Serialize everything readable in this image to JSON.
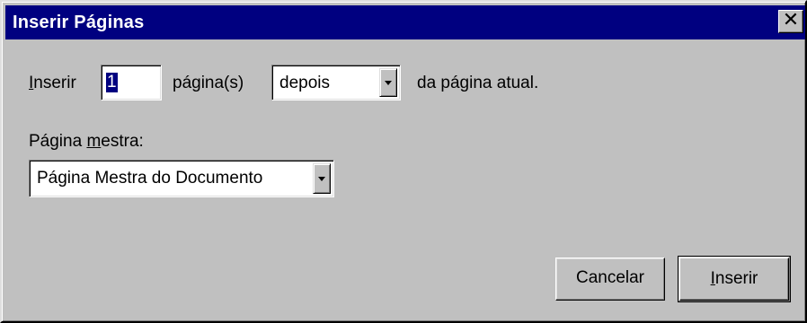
{
  "window": {
    "title": "Inserir Páginas",
    "close_glyph": "✕",
    "close_icon": "close-icon"
  },
  "insert_row": {
    "label_prefix_mnemonic": "I",
    "label_prefix_rest": "nserir",
    "count_value": "1",
    "unit_label": "página(s)",
    "position_selected": "depois",
    "suffix_label": "da página atual."
  },
  "master_page": {
    "label_before": "Página ",
    "label_mnemonic": "m",
    "label_after": "estra:",
    "selected": "Página Mestra do Documento"
  },
  "buttons": {
    "cancel_label": "Cancelar",
    "insert_mnemonic": "I",
    "insert_rest": "nserir"
  },
  "colors": {
    "titlebar": "#000080",
    "face": "#c0c0c0",
    "selection": "#000080"
  }
}
